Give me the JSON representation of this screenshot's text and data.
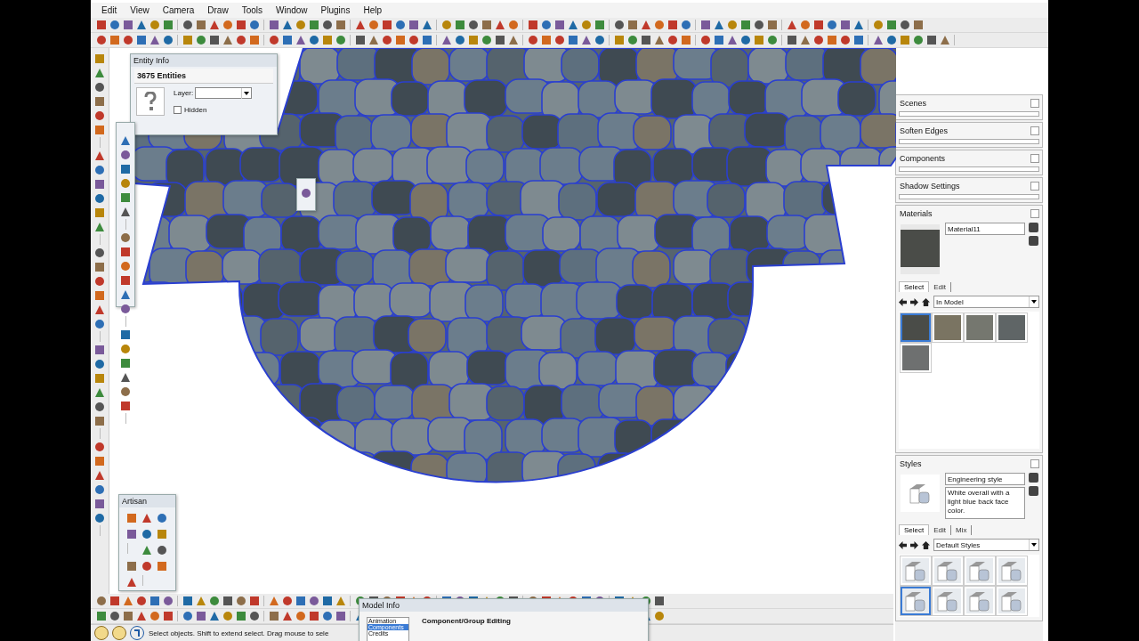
{
  "menu_bar": {
    "items": [
      "Edit",
      "View",
      "Camera",
      "Draw",
      "Tools",
      "Window",
      "Plugins",
      "Help"
    ]
  },
  "entity_info": {
    "title": "Entity Info",
    "heading": "3675 Entities",
    "layer_label": "Layer:",
    "hidden": {
      "label": "Hidden",
      "checked": false
    }
  },
  "artisan_palette": {
    "title": "Artisan"
  },
  "tray": {
    "collapsed_panels": [
      {
        "title": "Scenes"
      },
      {
        "title": "Soften Edges"
      },
      {
        "title": "Components"
      },
      {
        "title": "Shadow Settings"
      }
    ],
    "materials": {
      "title": "Materials",
      "name": "Material11",
      "tabs": [
        {
          "label": "Select",
          "selected": true
        },
        {
          "label": "Edit",
          "selected": false
        }
      ],
      "library": "In Model",
      "swatches": [
        {
          "color": "#4a4c48",
          "selected": true
        },
        {
          "color": "#7a7462",
          "selected": false
        },
        {
          "color": "#75776f",
          "selected": false
        },
        {
          "color": "#5f6566",
          "selected": false
        },
        {
          "color": "#6e7070",
          "selected": false
        }
      ]
    },
    "styles": {
      "title": "Styles",
      "name": "Engineering style",
      "description": "White overall with a light blue back face color.",
      "tabs": [
        {
          "label": "Select",
          "selected": true
        },
        {
          "label": "Edit",
          "selected": false
        },
        {
          "label": "Mix",
          "selected": false
        }
      ],
      "library": "Default Styles",
      "thumbnails": [
        {
          "selected": false
        },
        {
          "selected": false
        },
        {
          "selected": false
        },
        {
          "selected": false
        },
        {
          "selected": true
        },
        {
          "selected": false
        },
        {
          "selected": false
        },
        {
          "selected": false
        }
      ]
    }
  },
  "status_bar": {
    "hint": "Select objects. Shift to extend select. Drag mouse to sele"
  },
  "model_info": {
    "title": "Model Info",
    "categories": [
      {
        "label": "Animation",
        "selected": false
      },
      {
        "label": "Components",
        "selected": true
      },
      {
        "label": "Credits",
        "selected": false
      }
    ],
    "heading": "Component/Group Editing"
  }
}
